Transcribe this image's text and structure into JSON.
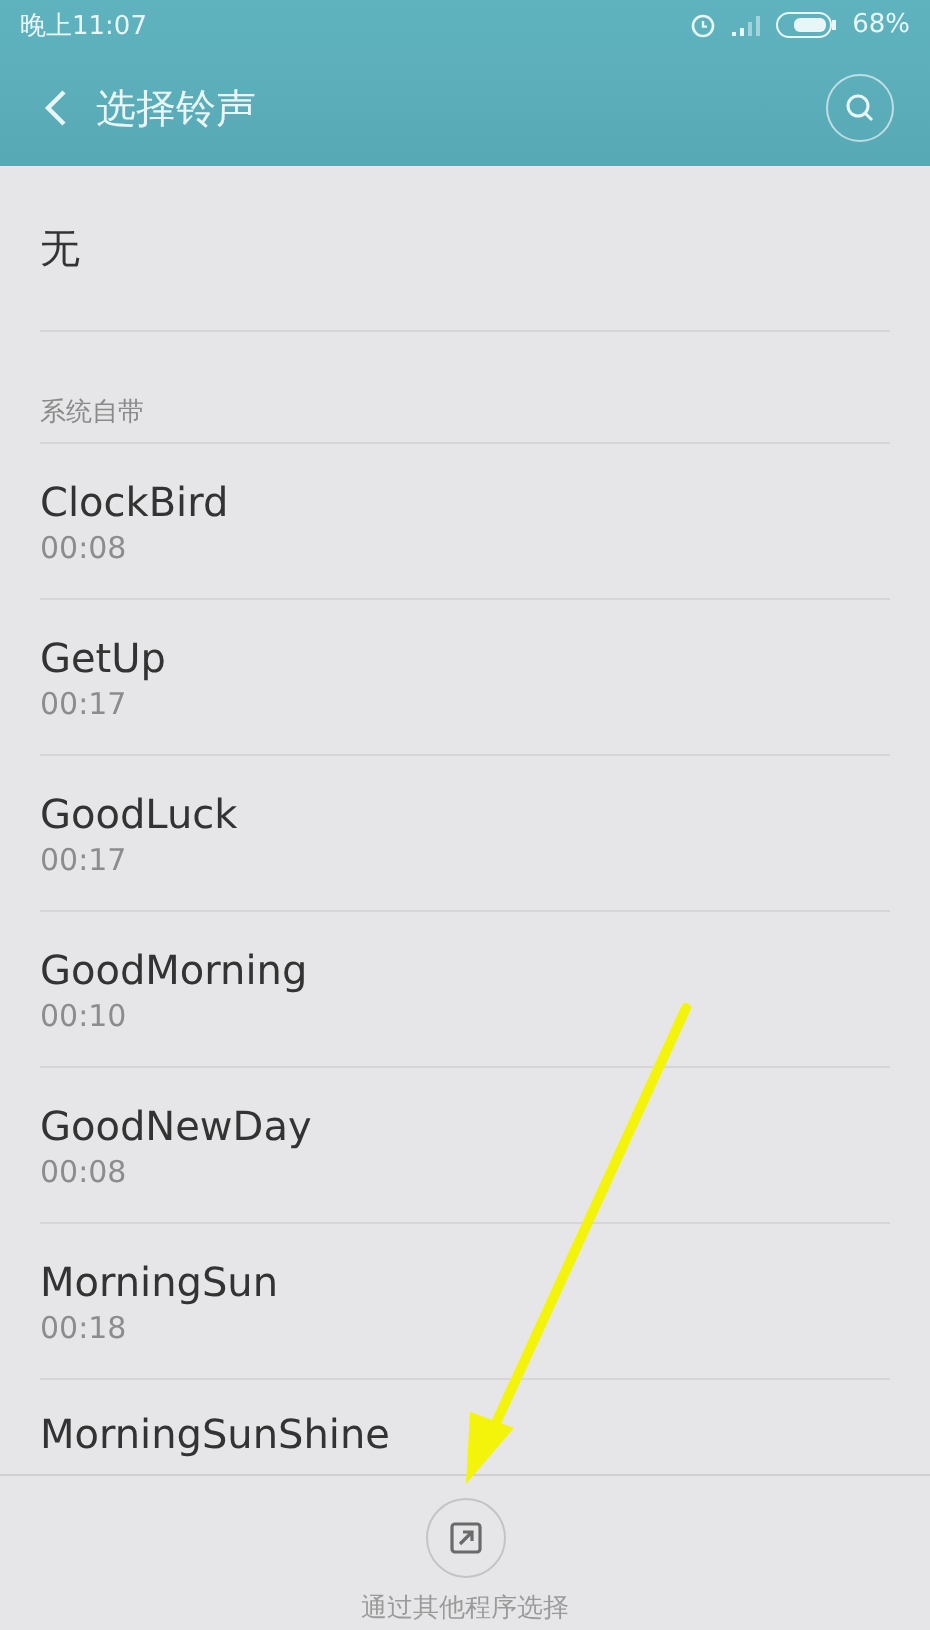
{
  "status_bar": {
    "time": "晚上11:07",
    "battery": "68%"
  },
  "header": {
    "title": "选择铃声"
  },
  "none_option": {
    "label": "无"
  },
  "section": {
    "title": "系统自带"
  },
  "ringtones": [
    {
      "name": "ClockBird",
      "duration": "00:08"
    },
    {
      "name": "GetUp",
      "duration": "00:17"
    },
    {
      "name": "GoodLuck",
      "duration": "00:17"
    },
    {
      "name": "GoodMorning",
      "duration": "00:10"
    },
    {
      "name": "GoodNewDay",
      "duration": "00:08"
    },
    {
      "name": "MorningSun",
      "duration": "00:18"
    },
    {
      "name": "MorningSunShine"
    }
  ],
  "bottom_action": {
    "label": "通过其他程序选择"
  }
}
